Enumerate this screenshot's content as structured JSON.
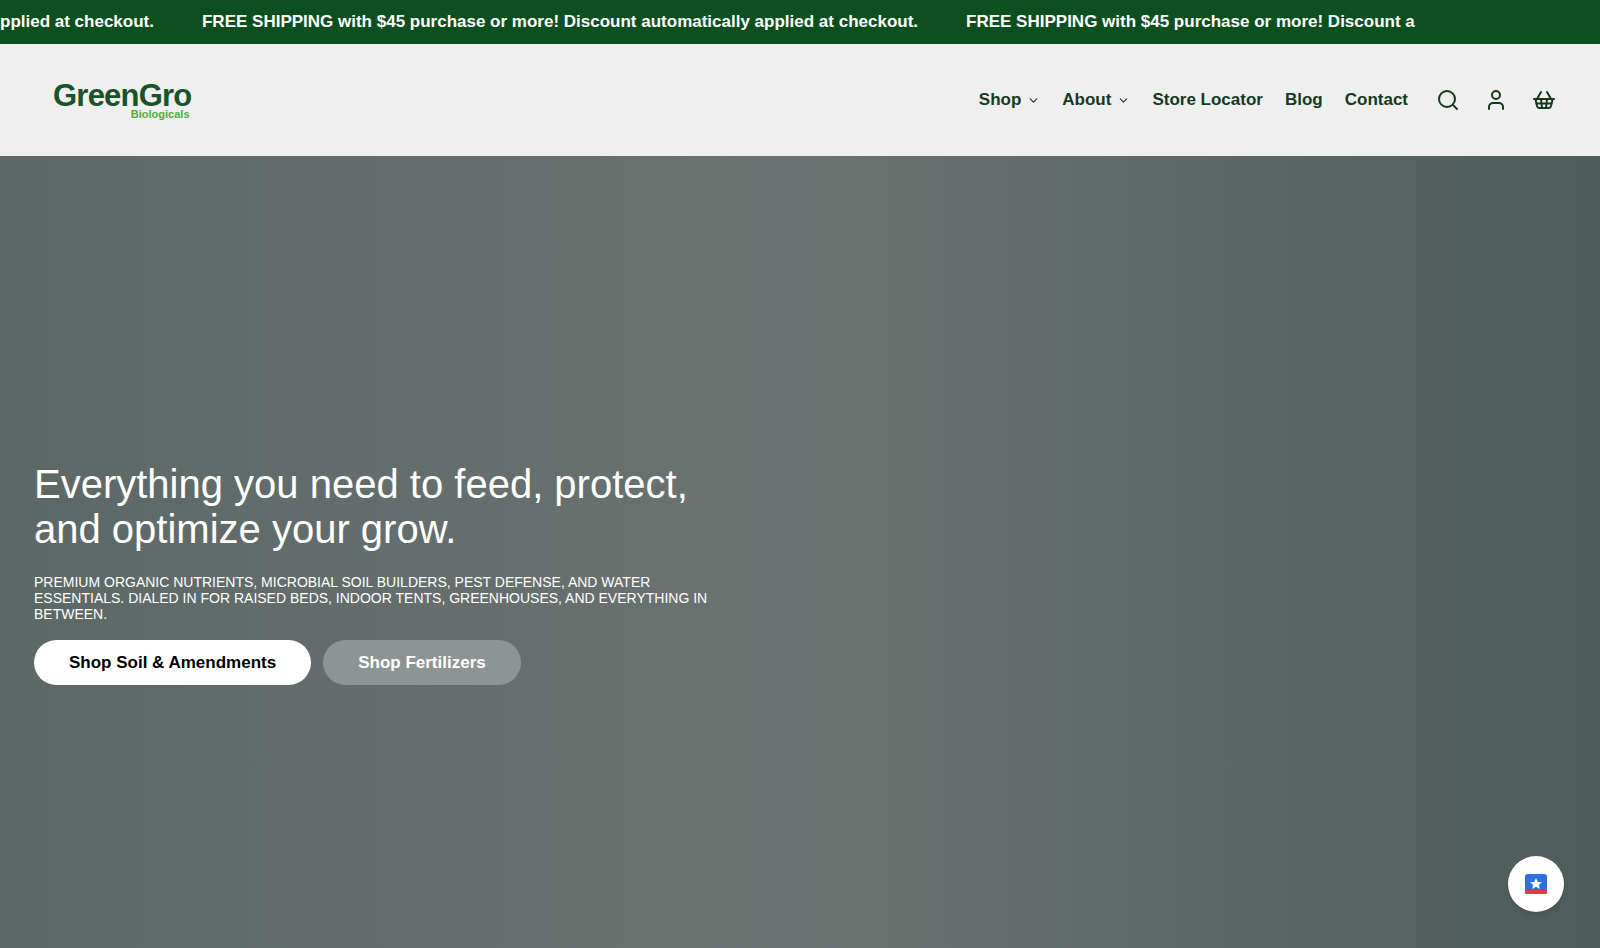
{
  "announcement_bar": {
    "messages": [
      "pplied at checkout.",
      "FREE SHIPPING with $45 purchase or more! Discount automatically applied at checkout.",
      "FREE SHIPPING with $45 purchase or more! Discount a"
    ]
  },
  "header": {
    "logo": {
      "name": "GreenGro",
      "tagline": "Biologicals"
    },
    "nav": [
      {
        "label": "Shop",
        "has_dropdown": true
      },
      {
        "label": "About",
        "has_dropdown": true
      },
      {
        "label": "Store Locator",
        "has_dropdown": false
      },
      {
        "label": "Blog",
        "has_dropdown": false
      },
      {
        "label": "Contact",
        "has_dropdown": false
      }
    ]
  },
  "hero": {
    "heading_lines": [
      "Everything you need to feed, protect,",
      "and optimize your grow."
    ],
    "subheading_lines": [
      "PREMIUM ORGANIC NUTRIENTS, MICROBIAL SOIL BUILDERS, PEST DEFENSE, AND WATER",
      "ESSENTIALS. DIALED IN FOR RAISED BEDS, INDOOR TENTS, GREENHOUSES, AND EVERYTHING IN",
      "BETWEEN."
    ],
    "buttons": [
      {
        "label": "Shop Soil & Amendments",
        "kind": "primary"
      },
      {
        "label": "Shop Fertilizers",
        "kind": "secondary"
      }
    ]
  }
}
